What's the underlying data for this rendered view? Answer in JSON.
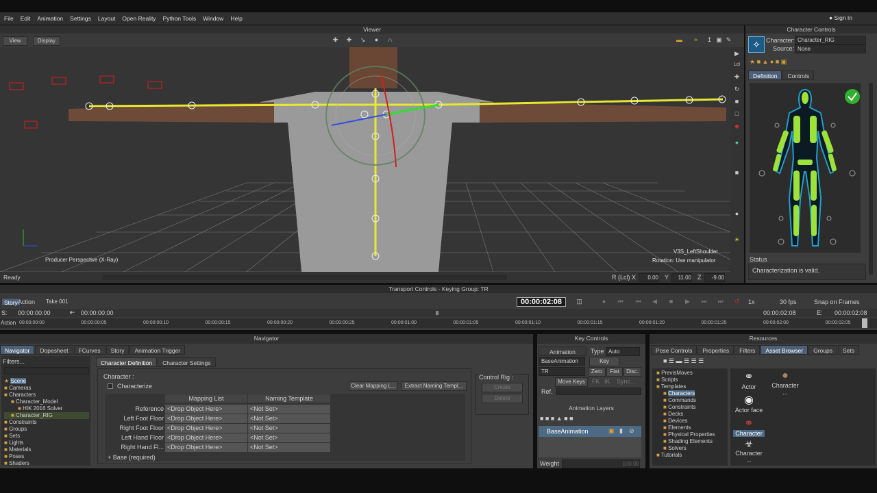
{
  "menu": [
    "File",
    "Edit",
    "Animation",
    "Settings",
    "Layout",
    "Open Reality",
    "Python Tools",
    "Window",
    "Help"
  ],
  "sign_in": "Sign In",
  "viewer": {
    "title": "Viewer",
    "view_btn": "View",
    "display_btn": "Display",
    "perspective": "Producer Perspective (X-Ray)",
    "selected": "V3S_LeftShoulder",
    "rotation": "Rotation: Use manipulator"
  },
  "status_bar": {
    "ready": "Ready",
    "r_label": "R (Lcl)",
    "x_label": "X",
    "x_val": "0.00",
    "y_label": "Y",
    "y_val": "11.00",
    "z_label": "Z",
    "z_val": "-9.00"
  },
  "char_controls": {
    "title": "Character Controls",
    "character_label": "Character:",
    "character_val": "Character_RIG",
    "source_label": "Source:",
    "source_val": "None",
    "tab_definition": "Definition",
    "tab_controls": "Controls",
    "status_label": "Status",
    "status_text": "Characterization is valid."
  },
  "transport": {
    "title": "Transport Controls  -  Keying Group: TR",
    "story": "Story",
    "action": "Action",
    "take": "Take 001",
    "time": "00:00:02:08",
    "speed": "1x",
    "fps": "30 fps",
    "snap": "Snap on Frames",
    "s_label": "S:",
    "s_val": "00:00:00:00",
    "ts_start": "00:00:00:00",
    "e_val1": "00:00:02:08",
    "e_label": "E:",
    "e_val2": "00:00:02:08",
    "action_label": "Action",
    "ticks": [
      "00:00:00:00",
      "00:00:00:05",
      "00:00:00:10",
      "00:00:00:15",
      "00:00:00:20",
      "00:00:00:25",
      "00:00:01:00",
      "00:00:01:05",
      "00:00:01:10",
      "00:00:01:15",
      "00:00:01:20",
      "00:00:01:25",
      "00:00:02:00",
      "00:00:02:05"
    ]
  },
  "navigator": {
    "title": "Navigator",
    "tabs": [
      "Navigator",
      "Dopesheet",
      "FCurves",
      "Story",
      "Animation Trigger"
    ],
    "filters": "Filters...",
    "tree": [
      "Scene",
      "Cameras",
      "Characters",
      "Character_Model",
      "HIK 2016 Solver",
      "Character_RIG",
      "Constraints",
      "Groups",
      "Sets",
      "Lights",
      "Materials",
      "Poses",
      "Shaders"
    ],
    "subtabs": [
      "Character Definition",
      "Character Settings"
    ],
    "character_label": "Character :",
    "characterize": "Characterize",
    "clear_mapping": "Clear Mapping L...",
    "extract_naming": "Extract Naming Templ...",
    "col_mapping": "Mapping List",
    "col_naming": "Naming Template",
    "rows": [
      {
        "name": "Reference",
        "drop": "<Drop Object Here>",
        "ns": "<Not Set>"
      },
      {
        "name": "Left Foot Floor",
        "drop": "<Drop Object Here>",
        "ns": "<Not Set>"
      },
      {
        "name": "Right Foot Floor",
        "drop": "<Drop Object Here>",
        "ns": "<Not Set>"
      },
      {
        "name": "Left Hand Floor",
        "drop": "<Drop Object Here>",
        "ns": "<Not Set>"
      },
      {
        "name": "Right Hand Fl...",
        "drop": "<Drop Object Here>",
        "ns": "<Not Set>"
      }
    ],
    "base_row": "Base (required)",
    "control_rig": "Control Rig :",
    "create": "Create",
    "delete": "Delete"
  },
  "key_controls": {
    "title": "Key Controls",
    "animation": "Animation",
    "type_label": "Type",
    "type_val": "Auto",
    "base_anim": "BaseAnimation",
    "key": "Key",
    "tr": "TR",
    "zero": "Zero",
    "flat": "Flat",
    "disc": "Disc.",
    "move_keys": "Move Keys",
    "fk": "FK",
    "ik": "IK",
    "sync": "Sync...",
    "ref": "Ref.",
    "layers_title": "Animation Layers",
    "layer_name": "BaseAnimation",
    "weight_label": "Weight",
    "weight_val": "100.00"
  },
  "resources": {
    "title": "Resources",
    "tabs": [
      "Pose Controls",
      "Properties",
      "Filters",
      "Asset Browser",
      "Groups",
      "Sets"
    ],
    "tree": [
      "PrevisMoves",
      "Scripts",
      "Templates",
      "Characters",
      "Commands",
      "Constraints",
      "Decks",
      "Devices",
      "Elements",
      "Physical Properties",
      "Shading Elements",
      "Solvers",
      "Tutorials"
    ],
    "assets": [
      "Actor",
      "Character ...",
      "Actor face",
      "Character",
      "Character ..."
    ]
  }
}
